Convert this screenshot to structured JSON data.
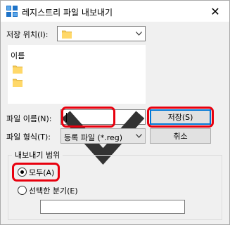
{
  "window": {
    "title": "레지스트리 파일 내보내기",
    "close_glyph": "✕"
  },
  "save_location": {
    "label": "저장 위치(I):",
    "value": ""
  },
  "list": {
    "header": "이름"
  },
  "filename": {
    "label": "파일 이름(N):",
    "value": ""
  },
  "filetype": {
    "label": "파일 형식(T):",
    "value": "등록 파일 (*.reg)"
  },
  "buttons": {
    "save_label": "저장(S)",
    "cancel_label": "취소"
  },
  "export_range": {
    "group_title": "내보내기 범위",
    "all_label": "모두(A)",
    "selected_branch_label": "선택한 분기(E)",
    "branch_value": "",
    "selected": "all"
  },
  "annotations": {
    "highlight_color": "#e8000e"
  },
  "icons": [
    "regedit-icon",
    "close-icon",
    "folder-icon",
    "chevron-down-icon"
  ]
}
